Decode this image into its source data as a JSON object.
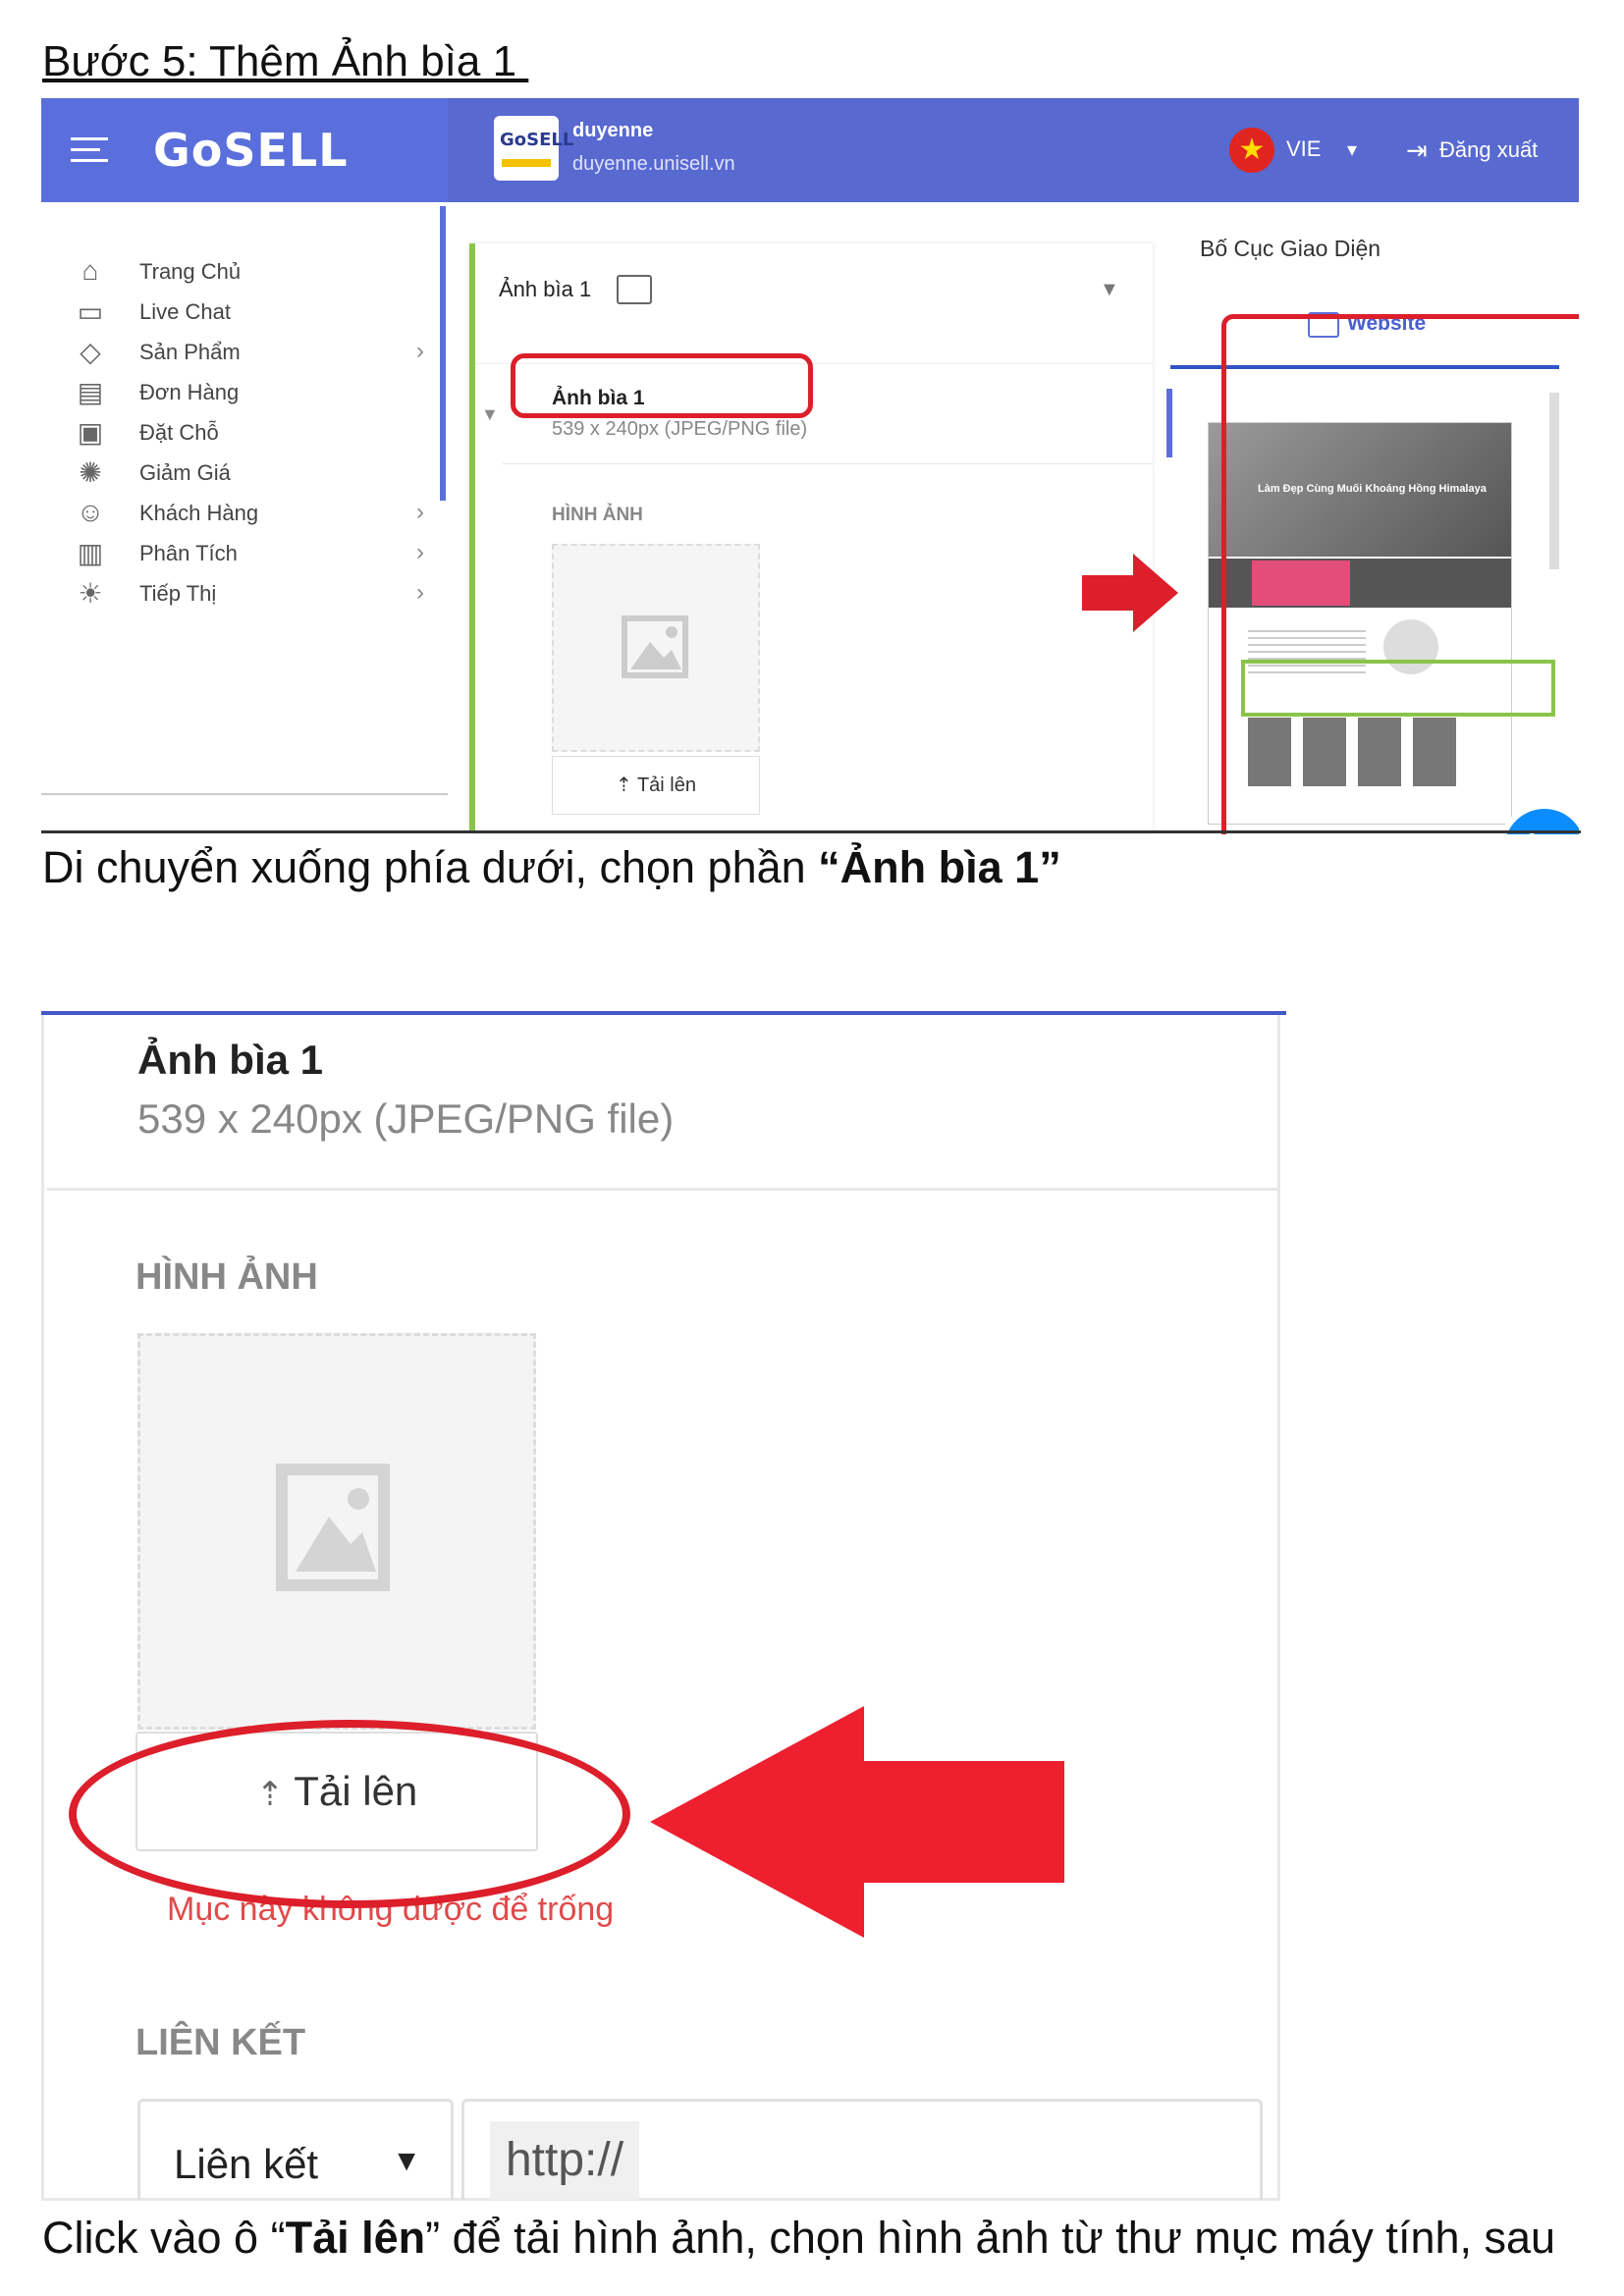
{
  "document": {
    "heading": "Bước 5: Thêm Ảnh bìa 1 ",
    "caption1_prefix": "Di chuyển xuống phía dưới, chọn phần ",
    "caption1_bold": "“Ảnh bìa 1”",
    "caption2_prefix": "Click vào ô “",
    "caption2_bold": "Tải lên",
    "caption2_suffix": "” để tải hình ảnh, chọn hình ảnh từ thư mục máy tính, sau"
  },
  "app": {
    "logo": "GoSELL",
    "store_badge": "GoSELL",
    "store_name": "duyenne",
    "store_url": "duyenne.unisell.vn",
    "language": "VIE",
    "logout_label": "Đăng xuất",
    "colors": {
      "header": "#5b6fdc",
      "accent": "#4a5ed0",
      "highlight_red": "#dc1f2b",
      "highlight_green": "#8bc34a",
      "messenger": "#0b8cff"
    }
  },
  "sidebar": {
    "items": [
      {
        "label": "Trang Chủ",
        "icon": "home-icon",
        "has_submenu": false
      },
      {
        "label": "Live Chat",
        "icon": "chat-icon",
        "has_submenu": false
      },
      {
        "label": "Sản Phẩm",
        "icon": "tag-icon",
        "has_submenu": true
      },
      {
        "label": "Đơn Hàng",
        "icon": "clipboard-icon",
        "has_submenu": false
      },
      {
        "label": "Đặt Chỗ",
        "icon": "calendar-icon",
        "has_submenu": false
      },
      {
        "label": "Giảm Giá",
        "icon": "discount-icon",
        "has_submenu": false
      },
      {
        "label": "Khách Hàng",
        "icon": "users-icon",
        "has_submenu": true
      },
      {
        "label": "Phân Tích",
        "icon": "analytics-icon",
        "has_submenu": true
      },
      {
        "label": "Tiếp Thị",
        "icon": "lightbulb-icon",
        "has_submenu": true
      }
    ]
  },
  "editor": {
    "section_select": "Ảnh bìa 1",
    "item_title": "Ảnh bìa 1",
    "item_subtitle": "539 x 240px (JPEG/PNG file)",
    "image_label": "HÌNH ẢNH",
    "upload_label": "Tải lên"
  },
  "layout_panel": {
    "title": "Bố Cục Giao Diện",
    "tab": "Website",
    "preview_text": "Làm Đẹp Cùng Muối Khoáng Hồng Himalaya"
  },
  "zoomed": {
    "title": "Ảnh bìa 1",
    "subtitle": "539 x 240px (JPEG/PNG file)",
    "image_label": "HÌNH ẢNH",
    "upload_label": "Tải lên",
    "error_text": "Mục này không được để trống",
    "link_label": "LIÊN KẾT",
    "link_type": "Liên kết",
    "url_prefix": "http://"
  }
}
